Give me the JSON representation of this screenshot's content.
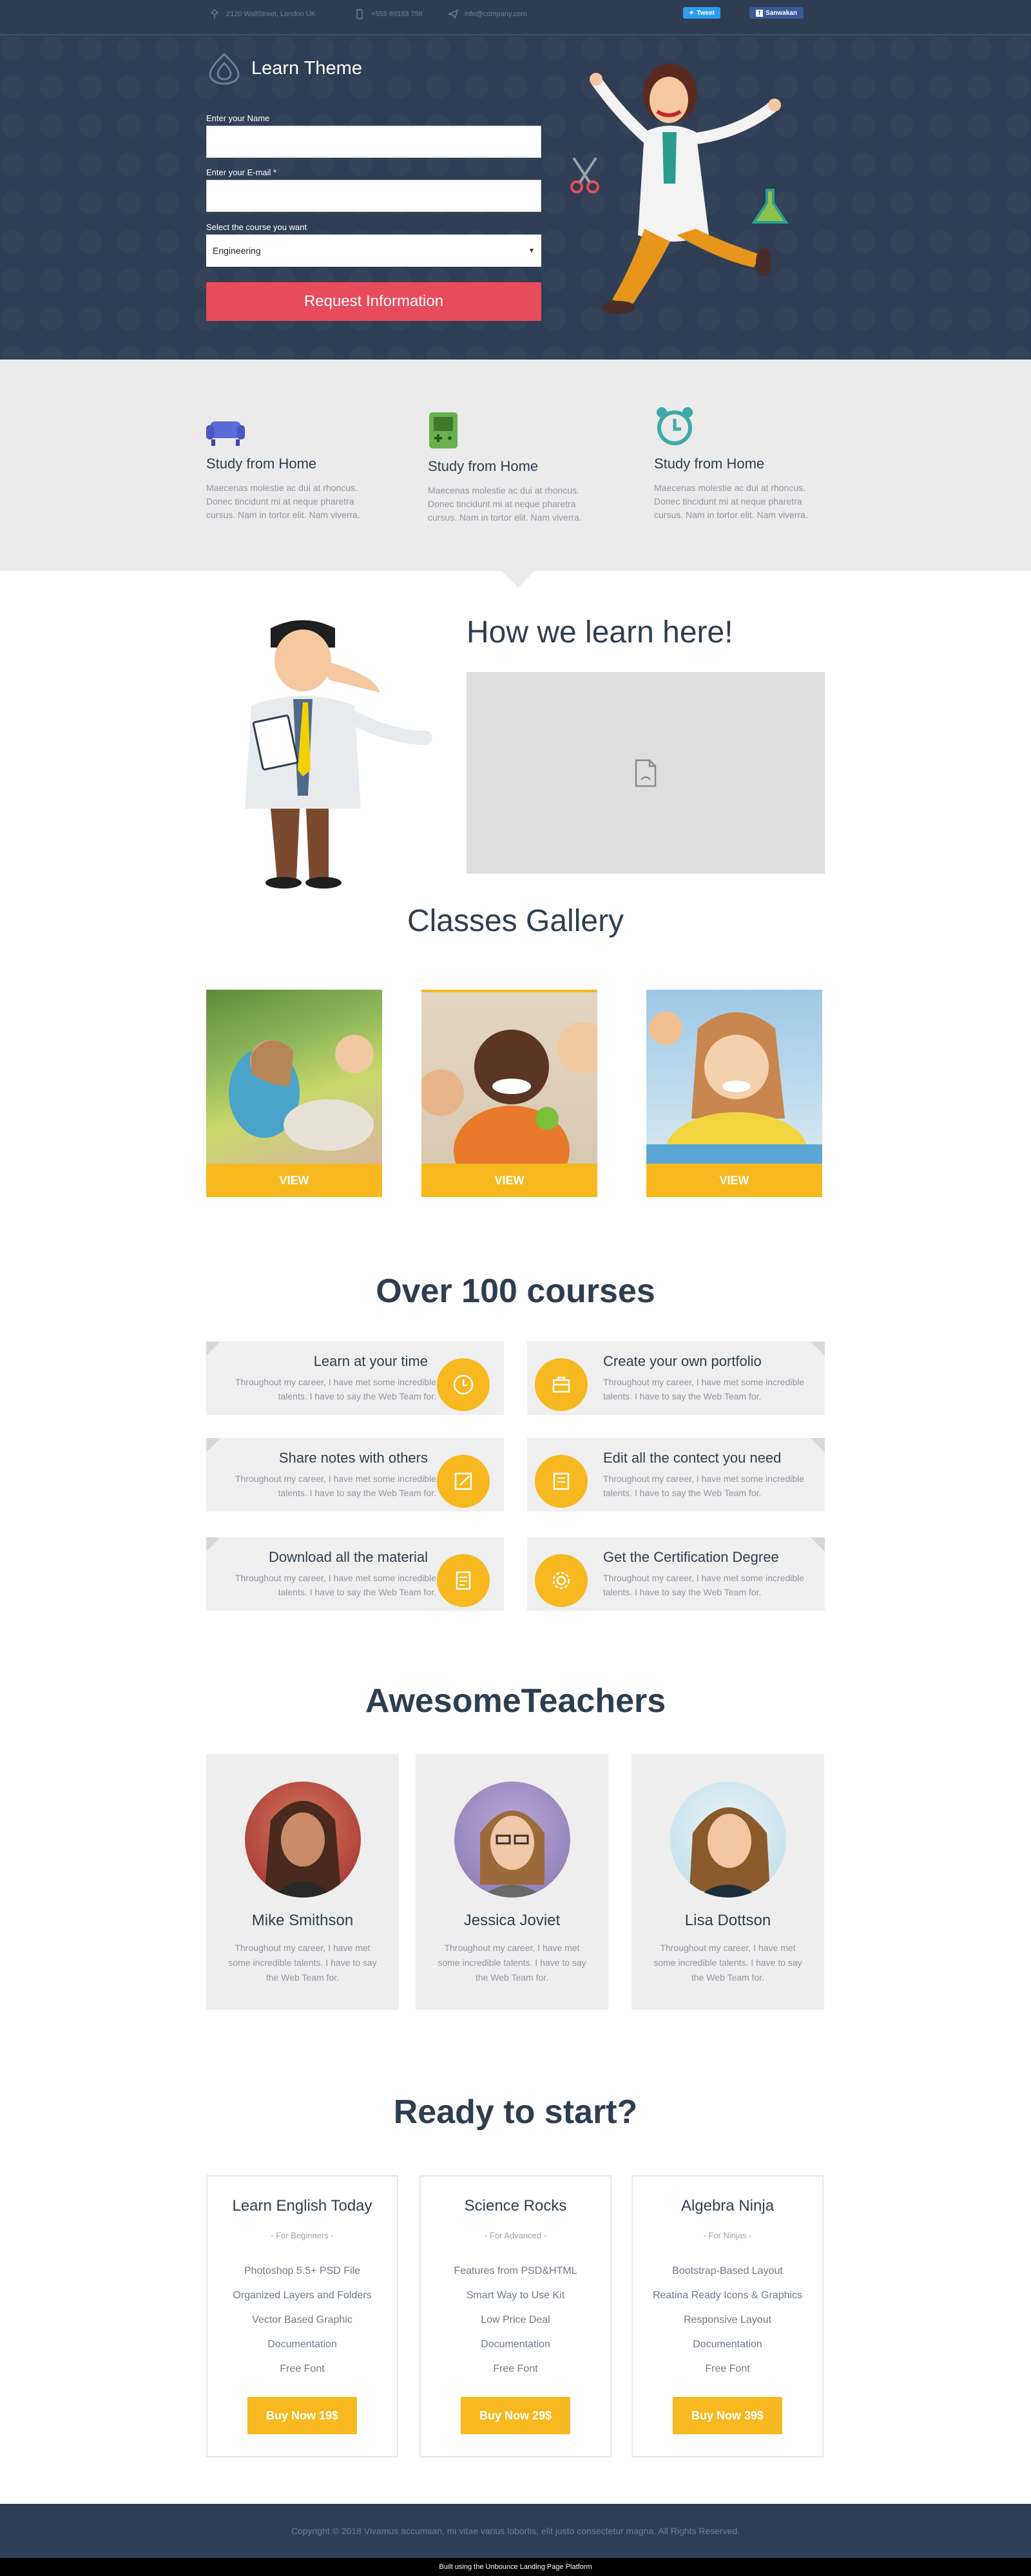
{
  "topbar": {
    "address": "2120 WallStreet, London UK",
    "phone": "+555 69183 756",
    "email": "info@company.com",
    "tweet_label": "Tweet",
    "share_label": "Sanwakan"
  },
  "hero": {
    "logo_text": "Learn Theme",
    "name_label": "Enter your Name",
    "email_label": "Enter your E-mail *",
    "course_label": "Select the course you want",
    "course_value": "Engineering",
    "submit_label": "Request Information"
  },
  "features": [
    {
      "title": "Study from Home",
      "text": "Maecenas molestie ac dui at rhoncus. Donec tincidunt mi at neque pharetra cursus. Nam in tortor elit. Nam viverra.",
      "icon": "armchair-icon"
    },
    {
      "title": "Study from Home",
      "text": "Maecenas molestie ac dui at rhoncus. Donec tincidunt mi at neque pharetra cursus. Nam in tortor elit. Nam viverra.",
      "icon": "game-console-icon"
    },
    {
      "title": "Study from Home",
      "text": "Maecenas molestie ac dui at rhoncus. Donec tincidunt mi at neque pharetra cursus. Nam in tortor elit. Nam viverra.",
      "icon": "alarm-clock-icon"
    }
  ],
  "learn": {
    "heading": "How we learn here!"
  },
  "gallery": {
    "heading": "Classes Gallery",
    "items": [
      {
        "button": "VIEW"
      },
      {
        "button": "VIEW"
      },
      {
        "button": "VIEW"
      }
    ]
  },
  "courses": {
    "heading": "Over 100 courses",
    "items": [
      {
        "title": "Learn at your time",
        "text": "Throughout my career, I have met some incredible talents. I have to say the Web Team for.",
        "icon": "clock-icon"
      },
      {
        "title": "Create your own portfolio",
        "text": "Throughout my career, I have met some incredible talents. I have to say the Web Team for.",
        "icon": "briefcase-icon"
      },
      {
        "title": "Share notes with others",
        "text": "Throughout my career, I have met some incredible talents. I have to say the Web Team for.",
        "icon": "pencil-icon"
      },
      {
        "title": "Edit all the contect you need",
        "text": "Throughout my career, I have met some incredible talents. I have to say the Web Team for.",
        "icon": "document-icon"
      },
      {
        "title": "Download all the material",
        "text": "Throughout my career, I have met some incredible talents. I have to say the Web Team for.",
        "icon": "download-icon"
      },
      {
        "title": "Get the Certification Degree",
        "text": "Throughout my career, I have met some incredible talents. I have to say the Web Team for.",
        "icon": "gear-icon"
      }
    ]
  },
  "teachers": {
    "heading": "AwesomeTeachers",
    "items": [
      {
        "name": "Mike Smithson",
        "text": "Throughout my career, I have met some incredible talents. I have to say the Web Team for."
      },
      {
        "name": "Jessica Joviet",
        "text": "Throughout my career, I have met some incredible talents. I have to say the Web Team for."
      },
      {
        "name": "Lisa Dottson",
        "text": "Throughout my career, I have met some incredible talents. I have to say the Web Team for."
      }
    ]
  },
  "pricing": {
    "heading": "Ready to start?",
    "plans": [
      {
        "title": "Learn English Today",
        "subtitle": "- For Beginners -",
        "features": [
          "Photoshop 5.5+ PSD File",
          "Organized Layers and Folders",
          "Vector Based Graphic",
          "Documentation",
          "Free Font"
        ],
        "button": "Buy Now 19$"
      },
      {
        "title": "Science Rocks",
        "subtitle": "- For Advanced -",
        "features": [
          "Features from PSD&HTML",
          "Smart Way to Use Kit",
          "Low Price Deal",
          "Documentation",
          "Free Font"
        ],
        "button": "Buy Now 29$"
      },
      {
        "title": "Algebra Ninja",
        "subtitle": "- For Ninjas -",
        "features": [
          "Bootstrap-Based Layout",
          "Reatina Ready Icons & Graphics",
          "Responsive Layout",
          "Documentation",
          "Free Font"
        ],
        "button": "Buy Now 39$"
      }
    ]
  },
  "footer": {
    "copyright": "Copyright © 2018 Vivamus accumsan, mi vitae varius lobortis, elit justo consectetur magna. All Rights Reserved.",
    "built_with": "Built using the Unbounce Landing Page Platform"
  },
  "colors": {
    "navy": "#2f3e54",
    "accent_red": "#e84c5a",
    "accent_yellow": "#f7b820",
    "light_gray": "#ebebeb"
  }
}
